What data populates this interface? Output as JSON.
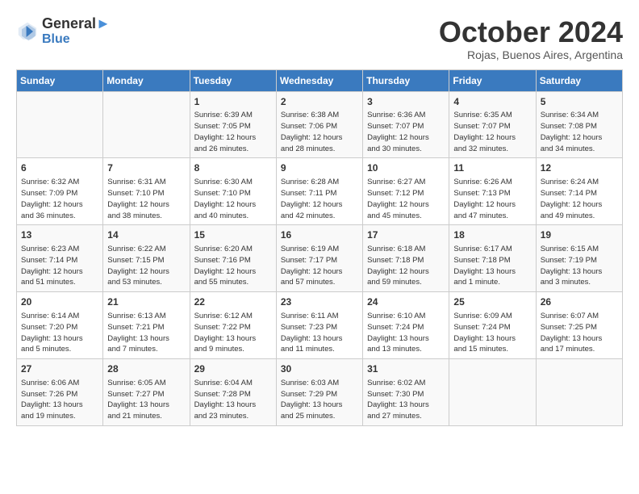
{
  "header": {
    "logo_line1": "General",
    "logo_line2": "Blue",
    "month": "October 2024",
    "location": "Rojas, Buenos Aires, Argentina"
  },
  "days_of_week": [
    "Sunday",
    "Monday",
    "Tuesday",
    "Wednesday",
    "Thursday",
    "Friday",
    "Saturday"
  ],
  "weeks": [
    [
      {
        "day": "",
        "info": ""
      },
      {
        "day": "",
        "info": ""
      },
      {
        "day": "1",
        "info": "Sunrise: 6:39 AM\nSunset: 7:05 PM\nDaylight: 12 hours\nand 26 minutes."
      },
      {
        "day": "2",
        "info": "Sunrise: 6:38 AM\nSunset: 7:06 PM\nDaylight: 12 hours\nand 28 minutes."
      },
      {
        "day": "3",
        "info": "Sunrise: 6:36 AM\nSunset: 7:07 PM\nDaylight: 12 hours\nand 30 minutes."
      },
      {
        "day": "4",
        "info": "Sunrise: 6:35 AM\nSunset: 7:07 PM\nDaylight: 12 hours\nand 32 minutes."
      },
      {
        "day": "5",
        "info": "Sunrise: 6:34 AM\nSunset: 7:08 PM\nDaylight: 12 hours\nand 34 minutes."
      }
    ],
    [
      {
        "day": "6",
        "info": "Sunrise: 6:32 AM\nSunset: 7:09 PM\nDaylight: 12 hours\nand 36 minutes."
      },
      {
        "day": "7",
        "info": "Sunrise: 6:31 AM\nSunset: 7:10 PM\nDaylight: 12 hours\nand 38 minutes."
      },
      {
        "day": "8",
        "info": "Sunrise: 6:30 AM\nSunset: 7:10 PM\nDaylight: 12 hours\nand 40 minutes."
      },
      {
        "day": "9",
        "info": "Sunrise: 6:28 AM\nSunset: 7:11 PM\nDaylight: 12 hours\nand 42 minutes."
      },
      {
        "day": "10",
        "info": "Sunrise: 6:27 AM\nSunset: 7:12 PM\nDaylight: 12 hours\nand 45 minutes."
      },
      {
        "day": "11",
        "info": "Sunrise: 6:26 AM\nSunset: 7:13 PM\nDaylight: 12 hours\nand 47 minutes."
      },
      {
        "day": "12",
        "info": "Sunrise: 6:24 AM\nSunset: 7:14 PM\nDaylight: 12 hours\nand 49 minutes."
      }
    ],
    [
      {
        "day": "13",
        "info": "Sunrise: 6:23 AM\nSunset: 7:14 PM\nDaylight: 12 hours\nand 51 minutes."
      },
      {
        "day": "14",
        "info": "Sunrise: 6:22 AM\nSunset: 7:15 PM\nDaylight: 12 hours\nand 53 minutes."
      },
      {
        "day": "15",
        "info": "Sunrise: 6:20 AM\nSunset: 7:16 PM\nDaylight: 12 hours\nand 55 minutes."
      },
      {
        "day": "16",
        "info": "Sunrise: 6:19 AM\nSunset: 7:17 PM\nDaylight: 12 hours\nand 57 minutes."
      },
      {
        "day": "17",
        "info": "Sunrise: 6:18 AM\nSunset: 7:18 PM\nDaylight: 12 hours\nand 59 minutes."
      },
      {
        "day": "18",
        "info": "Sunrise: 6:17 AM\nSunset: 7:18 PM\nDaylight: 13 hours\nand 1 minute."
      },
      {
        "day": "19",
        "info": "Sunrise: 6:15 AM\nSunset: 7:19 PM\nDaylight: 13 hours\nand 3 minutes."
      }
    ],
    [
      {
        "day": "20",
        "info": "Sunrise: 6:14 AM\nSunset: 7:20 PM\nDaylight: 13 hours\nand 5 minutes."
      },
      {
        "day": "21",
        "info": "Sunrise: 6:13 AM\nSunset: 7:21 PM\nDaylight: 13 hours\nand 7 minutes."
      },
      {
        "day": "22",
        "info": "Sunrise: 6:12 AM\nSunset: 7:22 PM\nDaylight: 13 hours\nand 9 minutes."
      },
      {
        "day": "23",
        "info": "Sunrise: 6:11 AM\nSunset: 7:23 PM\nDaylight: 13 hours\nand 11 minutes."
      },
      {
        "day": "24",
        "info": "Sunrise: 6:10 AM\nSunset: 7:24 PM\nDaylight: 13 hours\nand 13 minutes."
      },
      {
        "day": "25",
        "info": "Sunrise: 6:09 AM\nSunset: 7:24 PM\nDaylight: 13 hours\nand 15 minutes."
      },
      {
        "day": "26",
        "info": "Sunrise: 6:07 AM\nSunset: 7:25 PM\nDaylight: 13 hours\nand 17 minutes."
      }
    ],
    [
      {
        "day": "27",
        "info": "Sunrise: 6:06 AM\nSunset: 7:26 PM\nDaylight: 13 hours\nand 19 minutes."
      },
      {
        "day": "28",
        "info": "Sunrise: 6:05 AM\nSunset: 7:27 PM\nDaylight: 13 hours\nand 21 minutes."
      },
      {
        "day": "29",
        "info": "Sunrise: 6:04 AM\nSunset: 7:28 PM\nDaylight: 13 hours\nand 23 minutes."
      },
      {
        "day": "30",
        "info": "Sunrise: 6:03 AM\nSunset: 7:29 PM\nDaylight: 13 hours\nand 25 minutes."
      },
      {
        "day": "31",
        "info": "Sunrise: 6:02 AM\nSunset: 7:30 PM\nDaylight: 13 hours\nand 27 minutes."
      },
      {
        "day": "",
        "info": ""
      },
      {
        "day": "",
        "info": ""
      }
    ]
  ]
}
